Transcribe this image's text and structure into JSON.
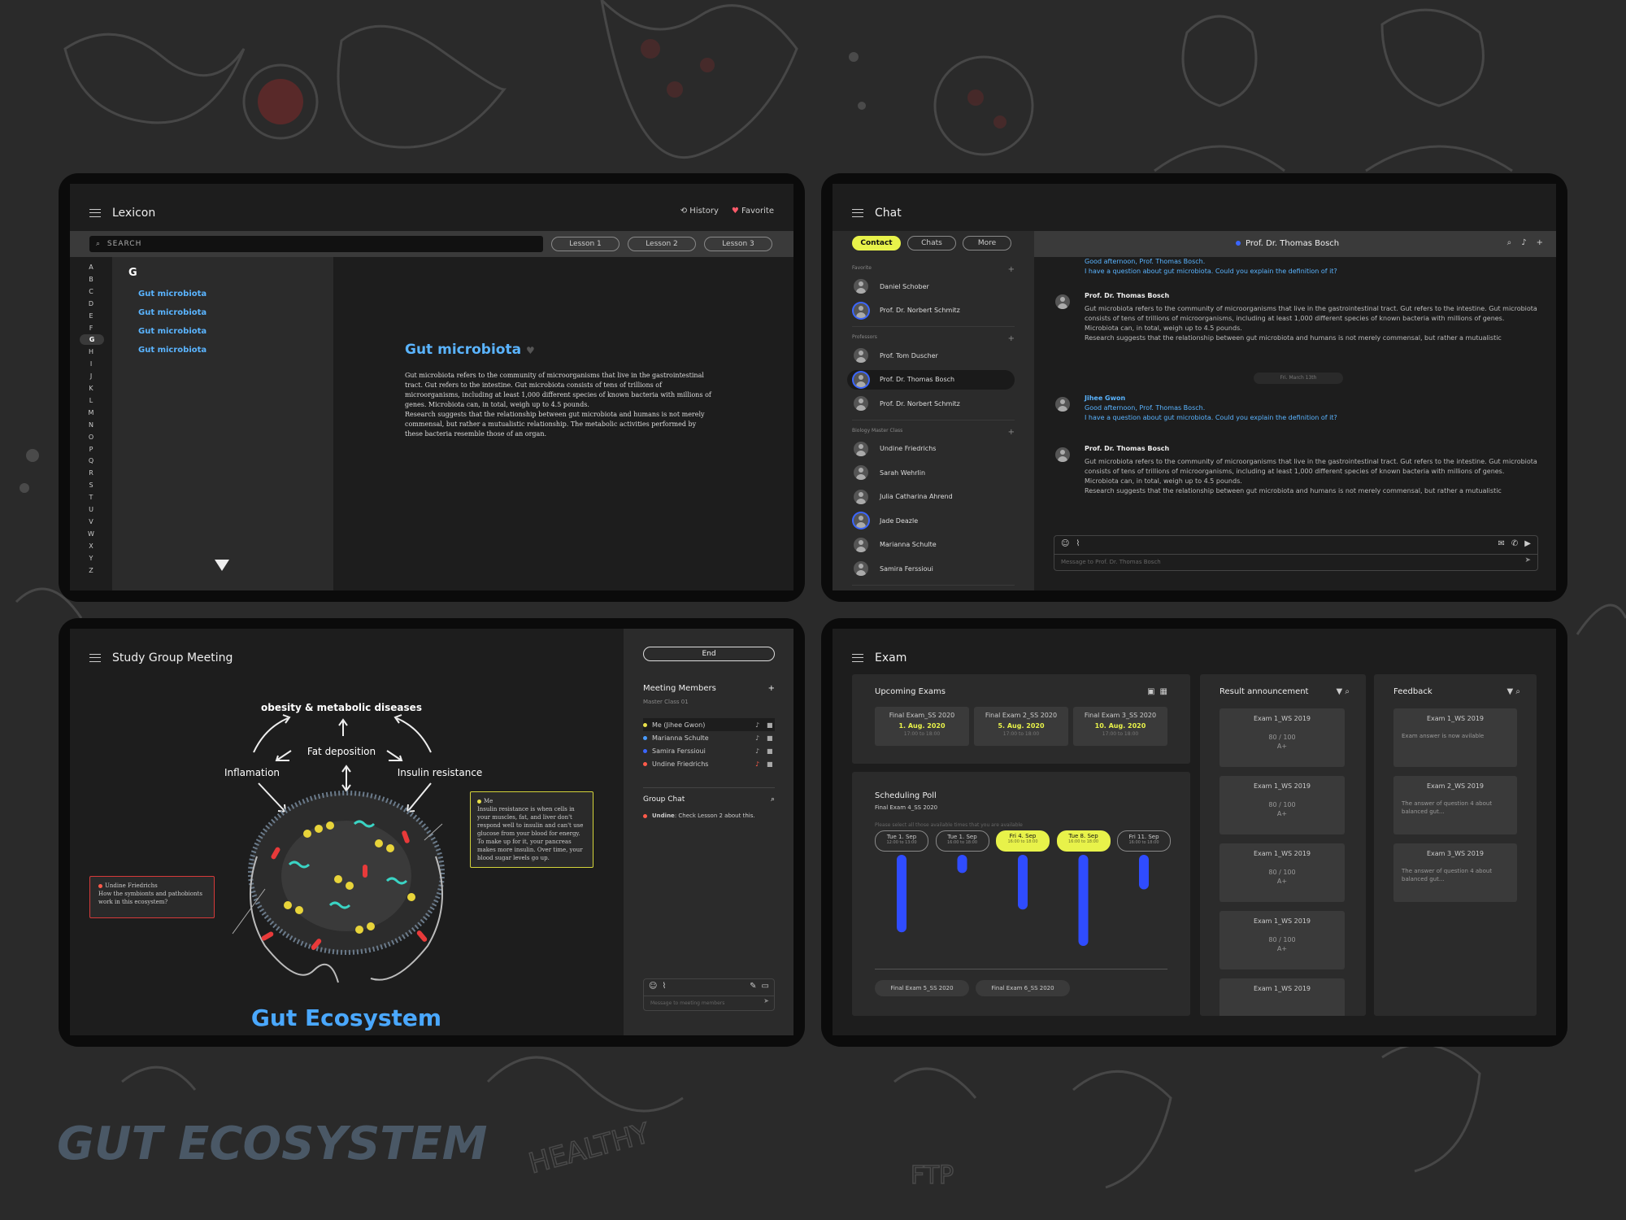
{
  "lexicon": {
    "title": "Lexicon",
    "history": "History",
    "favorite": "Favorite",
    "search_placeholder": "SEARCH",
    "lessons": [
      "Lesson 1",
      "Lesson 2",
      "Lesson 3"
    ],
    "alphabet": [
      "A",
      "B",
      "C",
      "D",
      "E",
      "F",
      "G",
      "H",
      "I",
      "J",
      "K",
      "L",
      "M",
      "N",
      "O",
      "P",
      "Q",
      "R",
      "S",
      "T",
      "U",
      "V",
      "W",
      "X",
      "Y",
      "Z"
    ],
    "active_letter": "G",
    "letter_heading": "G",
    "results": [
      "Gut microbiota",
      "Gut microbiota",
      "Gut microbiota",
      "Gut microbiota"
    ],
    "entry_title": "Gut microbiota",
    "entry_text": "Gut microbiota refers to the community of microorganisms that live in the gastrointestinal tract. Gut refers to the intestine. Gut microbiota consists of tens of trillions of microorganisms, including at least 1,000 different species of known bacteria with millions of genes. Microbiota can, in total, weigh up to 4.5 pounds.",
    "entry_text2": "Research suggests that the relationship between gut microbiota and humans is not merely commensal, but rather a mutualistic relationship. The metabolic activities performed by these bacteria resemble those of an organ."
  },
  "chat": {
    "title": "Chat",
    "tabs": [
      "Contact",
      "Chats",
      "More"
    ],
    "active_tab": "Contact",
    "header_name": "Prof. Dr. Thomas Bosch",
    "groups": [
      {
        "label": "Favorite",
        "members": [
          "Daniel Schober",
          "Prof. Dr. Norbert Schmitz"
        ]
      },
      {
        "label": "Professors",
        "members": [
          "Prof. Tom Duscher",
          "Prof. Dr. Thomas Bosch",
          "Prof. Dr. Norbert Schmitz"
        ]
      },
      {
        "label": "Biology Master Class",
        "members": [
          "Undine Friedrichs",
          "Sarah Wehrlin",
          "Julia Catharina Ahrend",
          "Jade Deazle",
          "Marianna Schulte",
          "Samira Ferssioui"
        ]
      }
    ],
    "top_lines": [
      "Good afternoon, Prof. Thomas Bosch.",
      "I have a question about gut microbiota. Could you explain the definition of it?"
    ],
    "prof_name": "Prof. Dr. Thomas Bosch",
    "prof_text": [
      "Gut microbiota refers to the community of microorganisms that live in the gastrointestinal tract. Gut refers to the intestine. Gut microbiota",
      "consists of tens of trillions of microorganisms, including at least 1,000 different species of known bacteria with millions of genes.",
      "Microbiota can, in total, weigh up to 4.5 pounds.",
      "Research suggests that the relationship between gut microbiota and humans is not merely commensal, but rather a mutualistic"
    ],
    "date_divider": "Fri. March 13th",
    "student_name": "Jihee Gwon",
    "input_placeholder": "Message to Prof. Dr. Thomas Bosch"
  },
  "meeting": {
    "title": "Study Group Meeting",
    "end_label": "End",
    "diagram_title": "obesity & metabolic diseases",
    "labels": {
      "fat": "Fat deposition",
      "inflam": "Inflamation",
      "insulin": "Insulin resistance"
    },
    "ecosystem": "Gut Ecosystem",
    "note_left_name": "Undine Friedrichs",
    "note_left_text": "How the symbionts and pathobionts work in this ecosystem?",
    "note_right_name": "Me",
    "note_right_text": "Insulin resistance is when cells in your muscles, fat, and liver don't respond well to insulin and can't use glucose from your blood for energy. To make up for it, your pancreas makes more insulin. Over time, your blood sugar levels go up.",
    "members_title": "Meeting Members",
    "members_sub": "Master Class 01",
    "members": [
      {
        "name": "Me (Jihee Gwon)",
        "color": "#e8e04a"
      },
      {
        "name": "Marianna Schulte",
        "color": "#4a9cff"
      },
      {
        "name": "Samira Ferssioui",
        "color": "#3b66ff"
      },
      {
        "name": "Undine Friedrichs",
        "color": "#ff5a4a"
      }
    ],
    "group_chat_title": "Group Chat",
    "group_msg_name": "Undine",
    "group_msg_text": ": Check  Lesson 2  about this.",
    "input_placeholder": "Message to meeting members"
  },
  "exam": {
    "title": "Exam",
    "upcoming_title": "Upcoming Exams",
    "upcoming": [
      {
        "name": "Final Exam_SS 2020",
        "date": "1. Aug. 2020",
        "time": "17:00 to 18:00"
      },
      {
        "name": "Final Exam 2_SS 2020",
        "date": "5. Aug. 2020",
        "time": "17:00 to 18:00"
      },
      {
        "name": "Final Exam 3_SS 2020",
        "date": "10. Aug. 2020",
        "time": "17:00 to 18:00"
      }
    ],
    "poll_title": "Scheduling Poll",
    "poll_sub": "Final Exam 4_SS 2020",
    "poll_hint": "Please select all those available times that you are available",
    "poll_slots": [
      {
        "day": "Tue 1. Sep",
        "time": "12:00 to 13:00",
        "sel": false,
        "votes": 0.85
      },
      {
        "day": "Tue 1. Sep",
        "time": "16:00 to 18:00",
        "sel": false,
        "votes": 0.2
      },
      {
        "day": "Fri 4. Sep",
        "time": "16:00 to 18:00",
        "sel": true,
        "votes": 0.6
      },
      {
        "day": "Tue 8. Sep",
        "time": "16:00 to 18:00",
        "sel": true,
        "votes": 1.0
      },
      {
        "day": "Fri 11. Sep",
        "time": "16:00 to 18:00",
        "sel": false,
        "votes": 0.38
      }
    ],
    "poll_more": [
      "Final Exam 5_SS 2020",
      "Final Exam 6_SS 2020"
    ],
    "results_title": "Result announcement",
    "results": [
      {
        "name": "Exam 1_WS 2019",
        "score": "80 / 100",
        "grade": "A+"
      },
      {
        "name": "Exam 1_WS 2019",
        "score": "80 / 100",
        "grade": "A+"
      },
      {
        "name": "Exam 1_WS 2019",
        "score": "80 / 100",
        "grade": "A+"
      },
      {
        "name": "Exam 1_WS 2019",
        "score": "80 / 100",
        "grade": "A+"
      },
      {
        "name": "Exam 1_WS 2019",
        "score": "",
        "grade": ""
      }
    ],
    "feedback_title": "Feedback",
    "feedback": [
      {
        "name": "Exam 1_WS 2019",
        "text": "Exam answer is now avilable"
      },
      {
        "name": "Exam 2_WS 2019",
        "text": "The answer of question 4 about balanced gut..."
      },
      {
        "name": "Exam 3_WS 2019",
        "text": "The answer of question 4 about balanced gut..."
      }
    ]
  },
  "background_text": {
    "gut": "GUT ECOSYSTEM",
    "healthy": "HEALTHY",
    "ftp": "FTP"
  },
  "colors": {
    "accent_yellow": "#e8f24a",
    "link_blue": "#5ab4ff",
    "bar_blue": "#2f4cff",
    "dark": "#1d1d1d"
  }
}
